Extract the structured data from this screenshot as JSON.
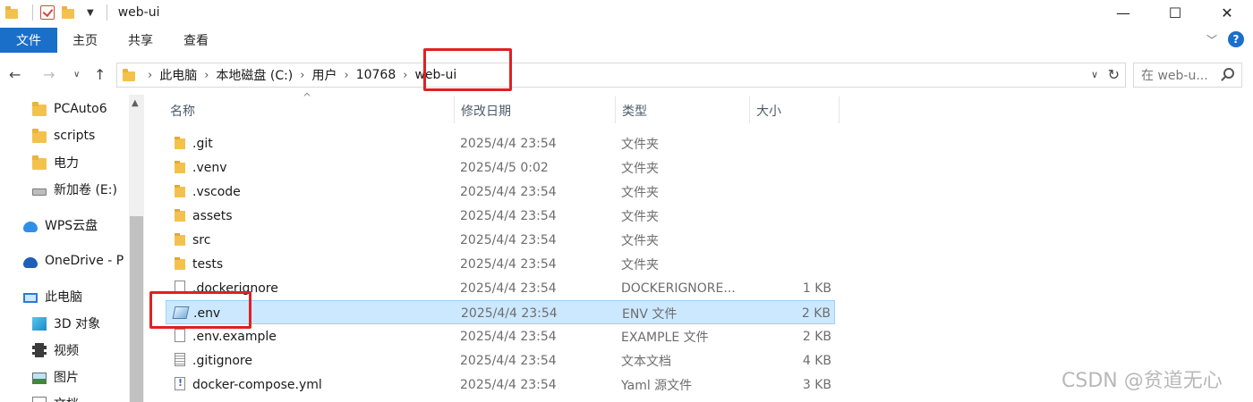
{
  "window": {
    "title": "web-ui",
    "minimize": "—",
    "maximize": "☐",
    "close": "✕"
  },
  "ribbon": {
    "tabs": [
      "文件",
      "主页",
      "共享",
      "查看"
    ]
  },
  "address": {
    "crumbs": [
      "此电脑",
      "本地磁盘 (C:)",
      "用户",
      "10768",
      "web-ui"
    ],
    "search_placeholder": "在 web-u..."
  },
  "nav": {
    "items": [
      {
        "label": "PCAuto6",
        "icon": "folder-icon"
      },
      {
        "label": "scripts",
        "icon": "folder-icon"
      },
      {
        "label": "电力",
        "icon": "folder-icon"
      },
      {
        "label": "新加卷 (E:)",
        "icon": "drive-icon"
      },
      {
        "label": "WPS云盘",
        "icon": "wps-cloud-icon"
      },
      {
        "label": "OneDrive - P",
        "icon": "onedrive-icon"
      },
      {
        "label": "此电脑",
        "icon": "computer-icon"
      },
      {
        "label": "3D 对象",
        "icon": "3d-objects-icon"
      },
      {
        "label": "视频",
        "icon": "video-icon"
      },
      {
        "label": "图片",
        "icon": "pictures-icon"
      },
      {
        "label": "文档",
        "icon": "documents-icon"
      }
    ]
  },
  "columns": {
    "name": "名称",
    "date": "修改日期",
    "type": "类型",
    "size": "大小"
  },
  "files": [
    {
      "name": ".git",
      "date": "2025/4/4 23:54",
      "type": "文件夹",
      "size": "",
      "icon": "folder-icon"
    },
    {
      "name": ".venv",
      "date": "2025/4/5 0:02",
      "type": "文件夹",
      "size": "",
      "icon": "folder-icon"
    },
    {
      "name": ".vscode",
      "date": "2025/4/4 23:54",
      "type": "文件夹",
      "size": "",
      "icon": "folder-icon"
    },
    {
      "name": "assets",
      "date": "2025/4/4 23:54",
      "type": "文件夹",
      "size": "",
      "icon": "folder-icon"
    },
    {
      "name": "src",
      "date": "2025/4/4 23:54",
      "type": "文件夹",
      "size": "",
      "icon": "folder-icon"
    },
    {
      "name": "tests",
      "date": "2025/4/4 23:54",
      "type": "文件夹",
      "size": "",
      "icon": "folder-icon"
    },
    {
      "name": ".dockerignore",
      "date": "2025/4/4 23:54",
      "type": "DOCKERIGNORE...",
      "size": "1 KB",
      "icon": "file-icon"
    },
    {
      "name": ".env",
      "date": "2025/4/4 23:54",
      "type": "ENV 文件",
      "size": "2 KB",
      "icon": "env-file-icon",
      "selected": true
    },
    {
      "name": ".env.example",
      "date": "2025/4/4 23:54",
      "type": "EXAMPLE 文件",
      "size": "2 KB",
      "icon": "file-icon"
    },
    {
      "name": ".gitignore",
      "date": "2025/4/4 23:54",
      "type": "文本文档",
      "size": "4 KB",
      "icon": "text-file-icon"
    },
    {
      "name": "docker-compose.yml",
      "date": "2025/4/4 23:54",
      "type": "Yaml 源文件",
      "size": "3 KB",
      "icon": "yaml-file-icon"
    }
  ],
  "watermark": "CSDN @贫道无心",
  "colors": {
    "accent": "#1a6fc9",
    "selection": "#cce8ff",
    "annotation": "#e02020"
  }
}
